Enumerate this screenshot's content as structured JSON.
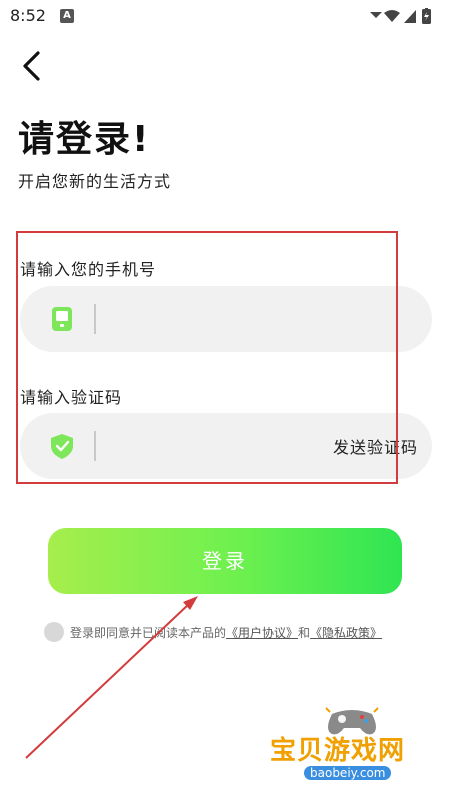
{
  "status_bar": {
    "time": "8:52",
    "app_badge": "A"
  },
  "header": {
    "title": "请登录!",
    "subtitle": "开启您新的生活方式"
  },
  "phone_field": {
    "label": "请输入您的手机号",
    "value": "",
    "placeholder": ""
  },
  "code_field": {
    "label": "请输入验证码",
    "value": "",
    "placeholder": "",
    "send_code_label": "发送验证码"
  },
  "login_button": {
    "label": "登录"
  },
  "agreement": {
    "prefix": "登录即同意并已阅读本产品的",
    "user_agreement": "《用户协议》",
    "conjunction": "和",
    "privacy_policy": "《隐私政策》",
    "checked": false
  },
  "watermark": {
    "title": "宝贝游戏网",
    "url": "baobeiy.com"
  },
  "colors": {
    "accent_green": "#6cf04f",
    "gradient_start": "#a6ee4c",
    "gradient_end": "#2fe552",
    "input_background": "#f1f1f1",
    "annotation_red": "#d23c3c",
    "watermark_orange": "#f0a000"
  },
  "icons": {
    "phone_icon": "phone-icon",
    "shield_icon": "shield-check-icon",
    "back_icon": "chevron-left-icon"
  }
}
